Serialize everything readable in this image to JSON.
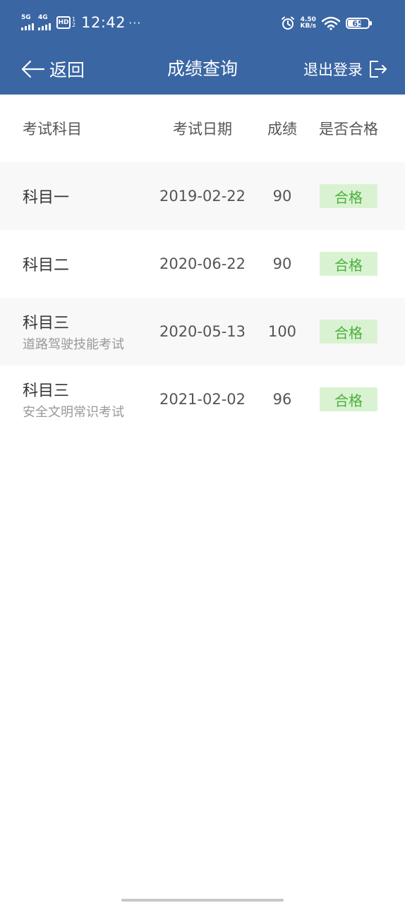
{
  "status_bar": {
    "net1": "5G",
    "net2": "4G",
    "hd": "HD",
    "hd_sub1": "1",
    "hd_sub2": "2",
    "time": "12:42",
    "dots": "···",
    "speed_value": "4.50",
    "speed_unit": "KB/s",
    "battery": "65"
  },
  "app_bar": {
    "back_label": "返回",
    "title": "成绩查询",
    "logout_label": "退出登录"
  },
  "table": {
    "headers": [
      "考试科目",
      "考试日期",
      "成绩",
      "是否合格"
    ],
    "rows": [
      {
        "subject": "科目一",
        "subtitle": "",
        "date": "2019-02-22",
        "score": "90",
        "status": "合格"
      },
      {
        "subject": "科目二",
        "subtitle": "",
        "date": "2020-06-22",
        "score": "90",
        "status": "合格"
      },
      {
        "subject": "科目三",
        "subtitle": "道路驾驶技能考试",
        "date": "2020-05-13",
        "score": "100",
        "status": "合格"
      },
      {
        "subject": "科目三",
        "subtitle": "安全文明常识考试",
        "date": "2021-02-02",
        "score": "96",
        "status": "合格"
      }
    ]
  },
  "icons": {
    "back": "arrow-left-icon",
    "logout": "logout-icon",
    "alarm": "alarm-icon",
    "wifi": "wifi-icon"
  },
  "colors": {
    "header_bg": "#3a66a3",
    "pass_badge_bg": "#d9f3d2",
    "pass_badge_text": "#4caf3e",
    "row_shade": "#f8f8f8"
  }
}
